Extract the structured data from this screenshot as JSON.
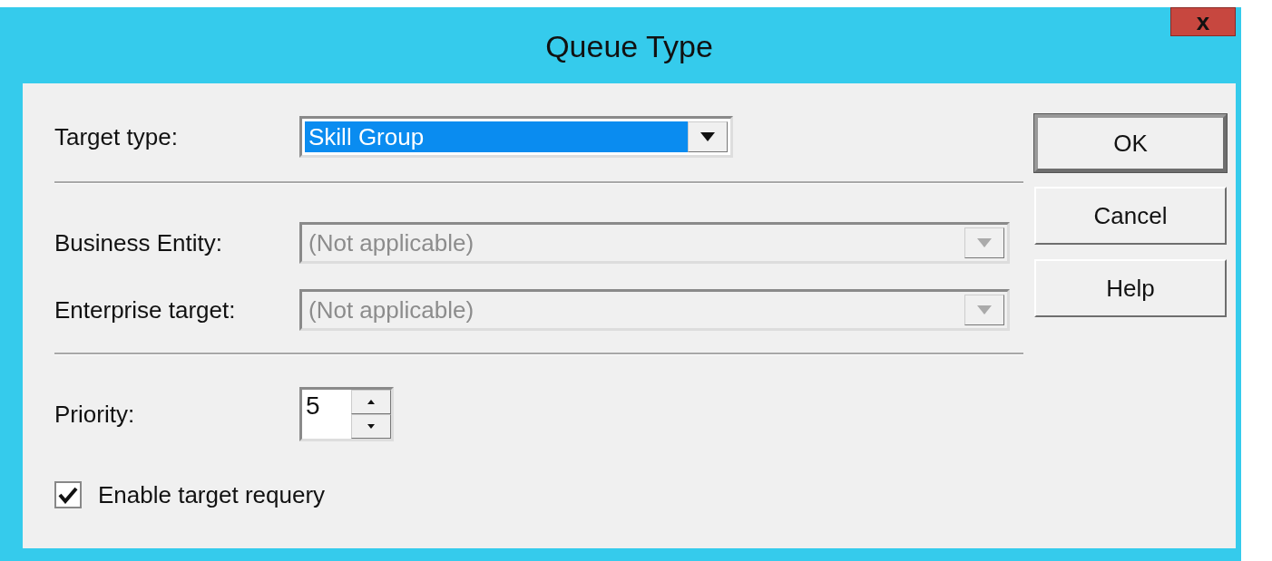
{
  "window": {
    "title": "Queue Type",
    "close": "x"
  },
  "target_type": {
    "label": "Target type:",
    "value": "Skill Group",
    "selected": true,
    "disabled": false
  },
  "fields": [
    {
      "label": "Business Entity:",
      "value": "(Not applicable)",
      "disabled": true
    },
    {
      "label": "Enterprise target:",
      "value": "(Not applicable)",
      "disabled": true
    }
  ],
  "priority": {
    "label": "Priority:",
    "value": "5"
  },
  "requery": {
    "label": "Enable target requery",
    "checked": true
  },
  "buttons": [
    {
      "label": "OK",
      "default": true
    },
    {
      "label": "Cancel",
      "default": false
    },
    {
      "label": "Help",
      "default": false
    }
  ]
}
